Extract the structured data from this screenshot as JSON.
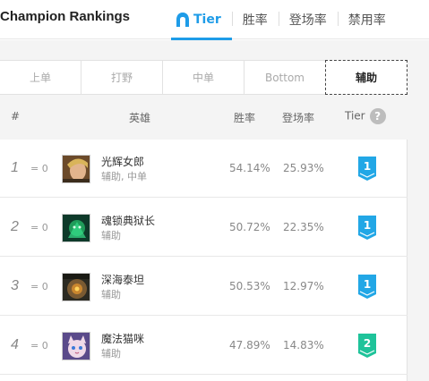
{
  "header": {
    "title": "Champion Rankings",
    "tabs": [
      {
        "label": "Tier",
        "active": true
      },
      {
        "label": "胜率",
        "active": false
      },
      {
        "label": "登场率",
        "active": false
      },
      {
        "label": "禁用率",
        "active": false
      }
    ],
    "accent_color": "#1e9ce8"
  },
  "roles": [
    {
      "label": "上单",
      "active": false
    },
    {
      "label": "打野",
      "active": false
    },
    {
      "label": "中单",
      "active": false
    },
    {
      "label": "Bottom",
      "active": false
    },
    {
      "label": "辅助",
      "active": true
    }
  ],
  "columns": {
    "rank": "#",
    "champion": "英雄",
    "winrate": "胜率",
    "pickrate": "登场率",
    "tier": "Tier",
    "help_icon": "?"
  },
  "rows": [
    {
      "rank": "1",
      "change": "= 0",
      "name": "光辉女郎",
      "positions": "辅助, 中单",
      "winrate": "54.14%",
      "pickrate": "25.93%",
      "tier": "1",
      "tier_color": "#22a7e6"
    },
    {
      "rank": "2",
      "change": "= 0",
      "name": "魂锁典狱长",
      "positions": "辅助",
      "winrate": "50.72%",
      "pickrate": "22.35%",
      "tier": "1",
      "tier_color": "#22a7e6"
    },
    {
      "rank": "3",
      "change": "= 0",
      "name": "深海泰坦",
      "positions": "辅助",
      "winrate": "50.53%",
      "pickrate": "12.97%",
      "tier": "1",
      "tier_color": "#22a7e6"
    },
    {
      "rank": "4",
      "change": "= 0",
      "name": "魔法猫咪",
      "positions": "辅助",
      "winrate": "47.89%",
      "pickrate": "14.83%",
      "tier": "2",
      "tier_color": "#1fc39a"
    }
  ]
}
